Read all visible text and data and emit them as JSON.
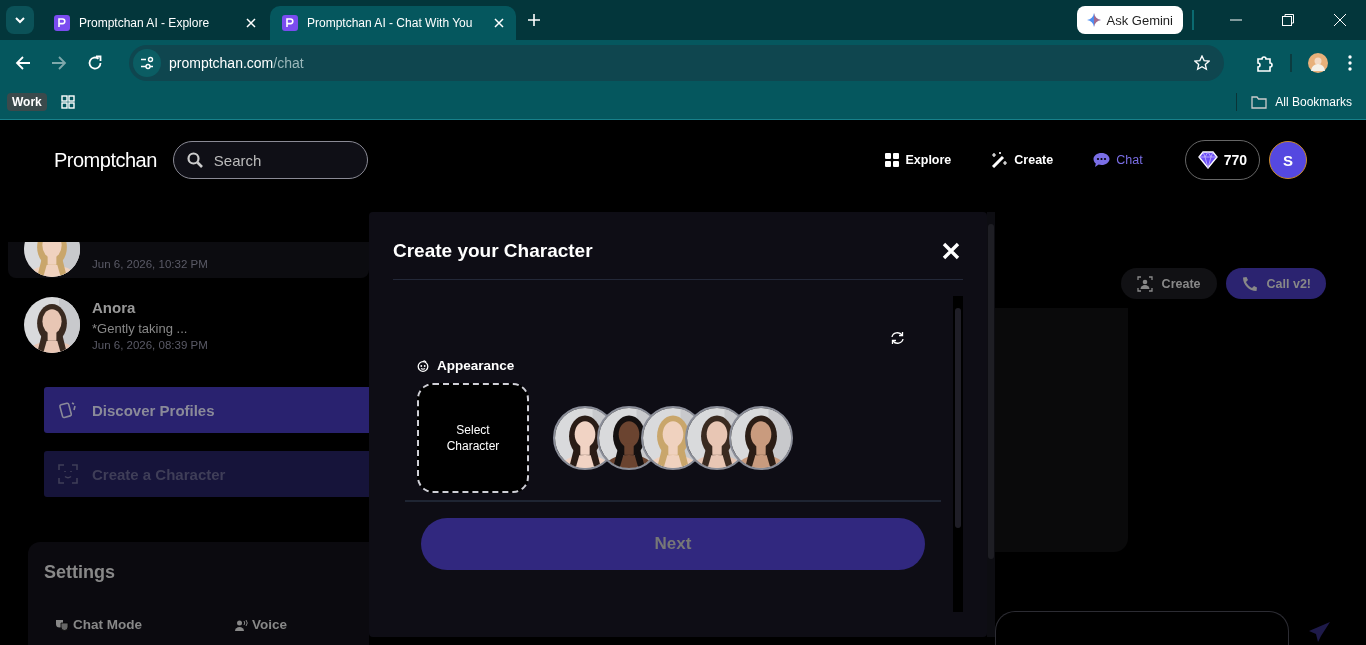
{
  "browser": {
    "tabs": [
      {
        "title": "Promptchan AI - Explore",
        "selected": false
      },
      {
        "title": "Promptchan AI - Chat With You",
        "selected": true
      }
    ],
    "gemini_button": "Ask Gemini",
    "address": {
      "host": "promptchan.com",
      "path": "/chat"
    },
    "bookmarks": {
      "work_label": "Work",
      "all_bookmarks": "All Bookmarks"
    }
  },
  "header": {
    "logo": "Promptchan",
    "search_placeholder": "Search",
    "nav": [
      {
        "label": "Explore",
        "kind": "explore",
        "selected": false
      },
      {
        "label": "Create",
        "kind": "create",
        "selected": false
      },
      {
        "label": "Chat",
        "kind": "chat",
        "selected": true
      }
    ],
    "gems": "770",
    "avatar_initial": "S"
  },
  "chats": [
    {
      "time": "Jun 6, 2026, 10:32 PM",
      "selected": true
    },
    {
      "name": "Anora",
      "preview": "*Gently taking ...",
      "time": "Jun 6, 2026, 08:39 PM",
      "selected": false
    }
  ],
  "actions": [
    {
      "label": "Discover Profiles",
      "kind": "discover"
    },
    {
      "label": "Create a Character",
      "kind": "create"
    }
  ],
  "settings": {
    "title": "Settings",
    "items": [
      {
        "label": "Chat Mode",
        "kind": "mode"
      },
      {
        "label": "Voice",
        "kind": "voice"
      }
    ]
  },
  "chat_toolbar": [
    {
      "label": "Create",
      "kind": "create"
    },
    {
      "label": "Call v2!",
      "kind": "call"
    }
  ],
  "modal": {
    "title": "Create your Character",
    "section": "Appearance",
    "select_label": "Select Character",
    "next_button": "Next"
  }
}
